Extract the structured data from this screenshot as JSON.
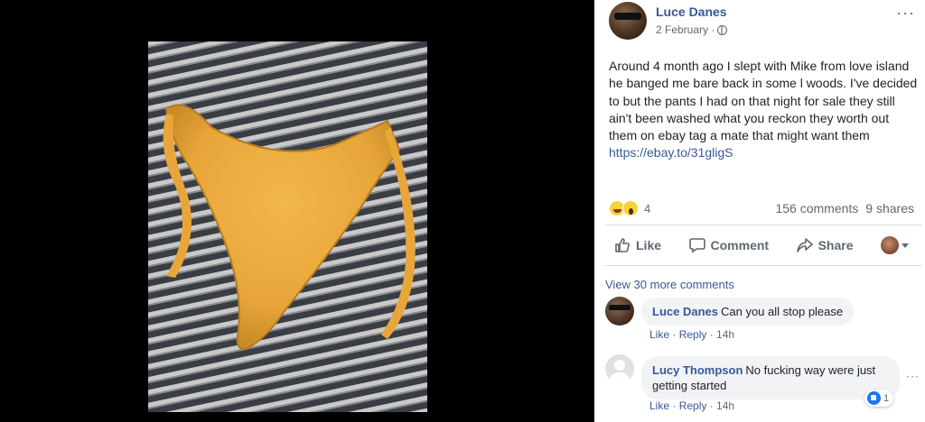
{
  "post": {
    "author": "Luce Danes",
    "date": "2 February · ",
    "text": "Around 4 month ago I slept with Mike from love island he banged me bare back in some l woods. I've decided to but the pants I had on that night for sale they still ain't been washed what you reckon they worth out them on ebay tag a mate that might want them ",
    "link": "https://ebay.to/31gligS",
    "menu_dots": "···"
  },
  "reactions": {
    "icons": [
      "laughing-emoji-icon",
      "wow-emoji-icon"
    ],
    "count": "4",
    "comments": "156 comments",
    "shares": "9 shares"
  },
  "actions": {
    "like": "Like",
    "comment": "Comment",
    "share": "Share"
  },
  "comments": {
    "view_more": "View 30 more comments",
    "items": [
      {
        "author": "Luce Danes",
        "text": "Can you all stop please",
        "like": "Like",
        "reply": "Reply",
        "time": " · 14h"
      },
      {
        "author": "Lucy Thompson",
        "text": "No fucking way were just getting started",
        "like": "Like",
        "reply": "Reply",
        "time": " · 14h",
        "reaction_count": "1"
      }
    ],
    "separator": " · "
  },
  "colors": {
    "link": "#385898",
    "secondary_text": "#606770",
    "bubble": "#f2f3f5",
    "like_blue": "#1877f2"
  }
}
